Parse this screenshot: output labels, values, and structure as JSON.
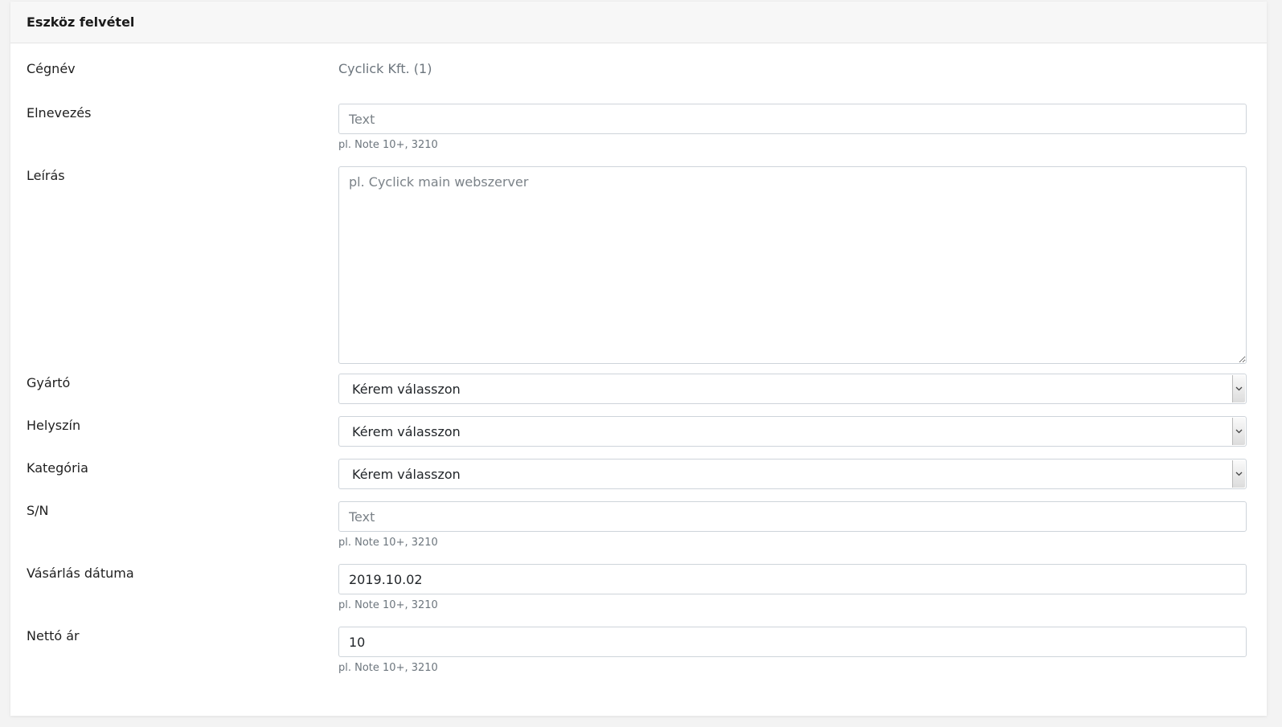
{
  "card": {
    "title": "Eszköz felvétel"
  },
  "company": {
    "label": "Cégnév",
    "value": "Cyclick Kft. (1)"
  },
  "name": {
    "label": "Elnevezés",
    "placeholder": "Text",
    "help": "pl. Note 10+, 3210"
  },
  "description": {
    "label": "Leírás",
    "placeholder": "pl. Cyclick main webszerver"
  },
  "manufacturer": {
    "label": "Gyártó",
    "selected": "Kérem válasszon",
    "icon": "chevron-down-icon"
  },
  "location": {
    "label": "Helyszín",
    "selected": "Kérem válasszon",
    "icon": "chevron-down-icon"
  },
  "category": {
    "label": "Kategória",
    "selected": "Kérem válasszon",
    "icon": "chevron-down-icon"
  },
  "serial": {
    "label": "S/N",
    "placeholder": "Text",
    "help": "pl. Note 10+, 3210"
  },
  "purchase_date": {
    "label": "Vásárlás dátuma",
    "value": "2019.10.02",
    "help": "pl. Note 10+, 3210"
  },
  "net_price": {
    "label": "Nettó ár",
    "value": "10",
    "help": "pl. Note 10+, 3210"
  }
}
